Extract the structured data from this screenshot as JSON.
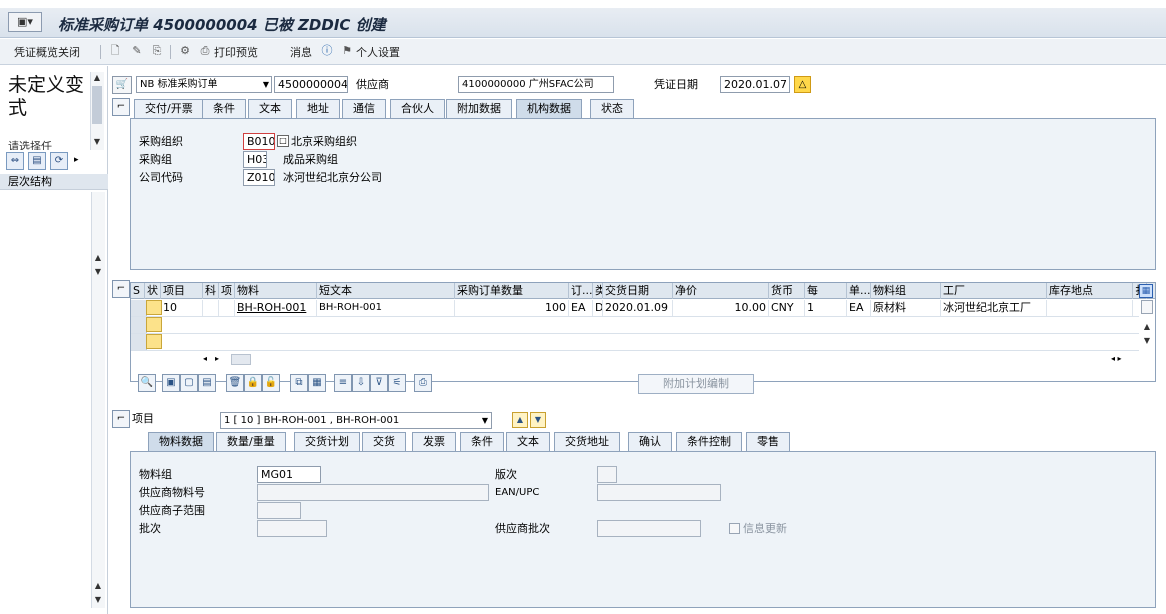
{
  "title": {
    "text": "标准采购订单 4500000004 已被 ZDDIC 创建",
    "icon": "purchase-order-icon"
  },
  "toolbar": {
    "close_overview": "凭证概览关闭",
    "print_preview": "打印预览",
    "messages": "消息",
    "personal_settings": "个人设置"
  },
  "left": {
    "big_text": "未定义变式",
    "sub_text": "请选择任",
    "tree_header": "层次结构"
  },
  "header": {
    "doc_type": "NB 标准采购订单",
    "po_number": "4500000004",
    "vendor_label": "供应商",
    "vendor_value": "4100000000 广州SFAC公司",
    "doc_date_label": "凭证日期",
    "doc_date_value": "2020.01.07"
  },
  "header_tabs": [
    {
      "label": "交付/开票"
    },
    {
      "label": "条件"
    },
    {
      "label": "文本"
    },
    {
      "label": "地址"
    },
    {
      "label": "通信"
    },
    {
      "label": "合伙人"
    },
    {
      "label": "附加数据"
    },
    {
      "label": "机构数据",
      "active": true
    },
    {
      "label": "状态"
    }
  ],
  "org_data": {
    "purch_org_label": "采购组织",
    "purch_org_value": "B010",
    "purch_org_desc": "北京采购组织",
    "purch_group_label": "采购组",
    "purch_group_value": "H03",
    "purch_group_desc": "成品采购组",
    "company_code_label": "公司代码",
    "company_code_value": "Z010",
    "company_code_desc": "冰河世纪北京分公司"
  },
  "items_grid": {
    "columns": [
      "S",
      "状",
      "项目",
      "科",
      "项",
      "物料",
      "短文本",
      "采购订单数量",
      "订...",
      "类",
      "交货日期",
      "净价",
      "货币",
      "每",
      "单...",
      "物料组",
      "工厂",
      "库存地点",
      "扌"
    ],
    "rows": [
      {
        "item": "10",
        "material": "BH-ROH-001",
        "short_text": "BH-ROH-001",
        "quantity": "100",
        "unit": "EA",
        "date_cat": "D",
        "delivery_date": "2020.01.09",
        "net_price": "10.00",
        "currency": "CNY",
        "per": "1",
        "order_unit": "EA",
        "material_group": "原材料",
        "plant": "冰河世纪北京工厂"
      }
    ]
  },
  "buttons": {
    "additional_planning": "附加计划编制"
  },
  "item_detail": {
    "label": "项目",
    "selected_item": "1 [ 10 ] BH-ROH-001 , BH-ROH-001"
  },
  "item_tabs": [
    {
      "label": "物料数据",
      "active": true
    },
    {
      "label": "数量/重量"
    },
    {
      "label": "交货计划"
    },
    {
      "label": "交货"
    },
    {
      "label": "发票"
    },
    {
      "label": "条件"
    },
    {
      "label": "文本"
    },
    {
      "label": "交货地址"
    },
    {
      "label": "确认"
    },
    {
      "label": "条件控制"
    },
    {
      "label": "零售"
    }
  ],
  "material_data": {
    "material_group_label": "物料组",
    "material_group_value": "MG01",
    "revision_label": "版次",
    "vendor_material_label": "供应商物料号",
    "ean_label": "EAN/UPC",
    "vendor_subrange_label": "供应商子范围",
    "batch_label": "批次",
    "vendor_batch_label": "供应商批次",
    "info_update_label": "信息更新"
  }
}
